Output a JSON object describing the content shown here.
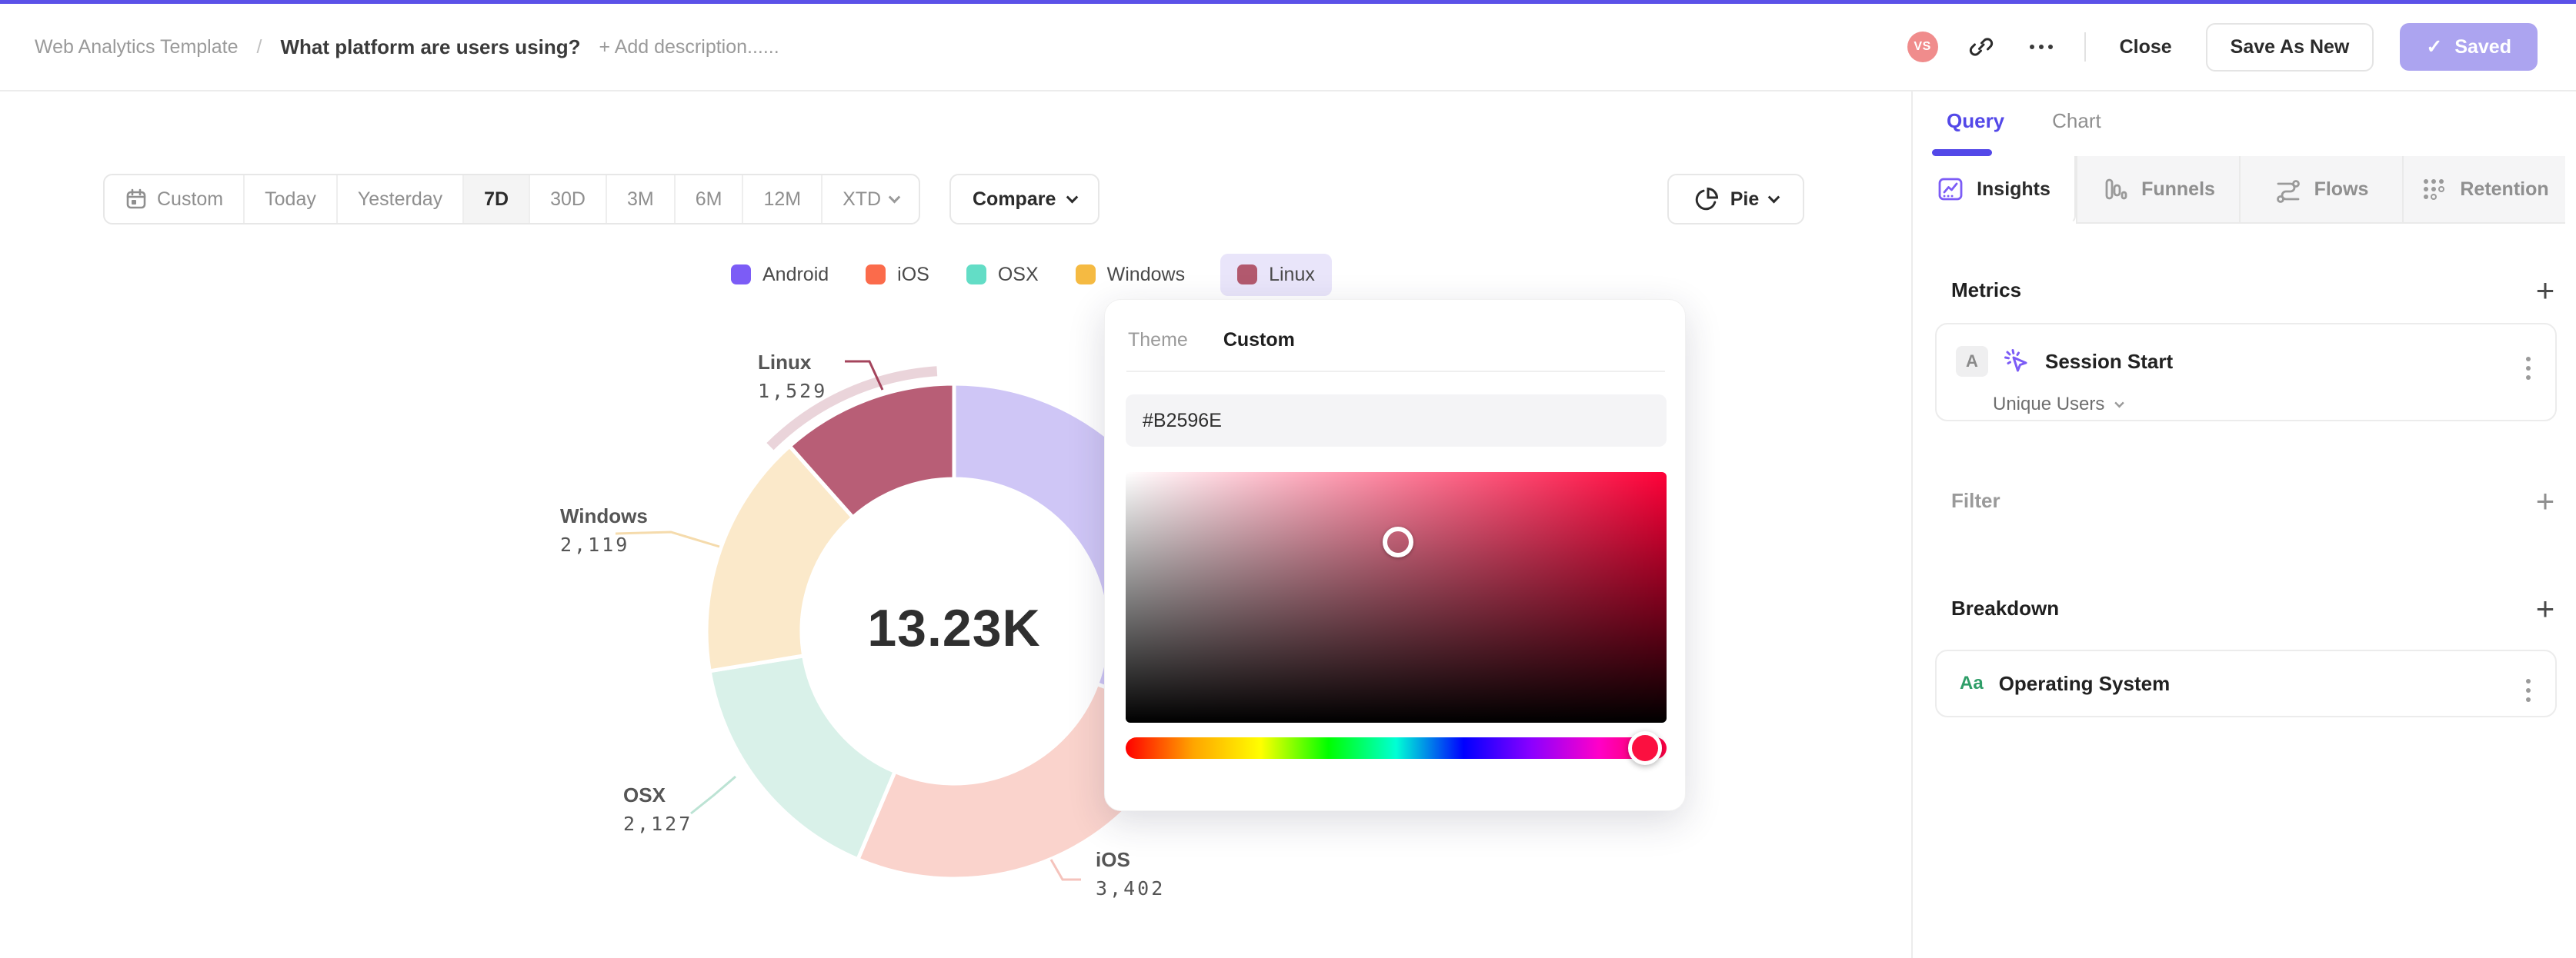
{
  "accent_color": "#5B51E8",
  "header": {
    "breadcrumb_root": "Web Analytics Template",
    "slash": "/",
    "title": "What platform are users using?",
    "add_description_label": "+ Add description......",
    "avatar_initials": "VS",
    "close_label": "Close",
    "save_as_new_label": "Save As New",
    "saved_label": "Saved",
    "saved_check": "✓",
    "saved_bg": "#ACA4F0"
  },
  "toolbar": {
    "ranges": [
      "Custom",
      "Today",
      "Yesterday",
      "7D",
      "30D",
      "3M",
      "6M",
      "12M",
      "XTD"
    ],
    "selected_range": "7D",
    "compare_label": "Compare",
    "chart_type_label": "Pie"
  },
  "chart_data": {
    "type": "pie",
    "center_label": "13.23K",
    "total": 13230,
    "legend_position": "top",
    "series": [
      {
        "name": "Android",
        "value": 4053,
        "color": "#7C5CF6",
        "slice_color": "#CFC6F6",
        "label_visible": false
      },
      {
        "name": "iOS",
        "value": 3402,
        "display_value": "3,402",
        "color": "#FB6B4B",
        "slice_color": "#FAD3CC",
        "label_visible": true
      },
      {
        "name": "OSX",
        "value": 2127,
        "display_value": "2,127",
        "color": "#63DDC6",
        "slice_color": "#D9F1E9",
        "label_visible": true
      },
      {
        "name": "Windows",
        "value": 2119,
        "display_value": "2,119",
        "color": "#F5BA42",
        "slice_color": "#FBE9CA",
        "label_visible": true
      },
      {
        "name": "Linux",
        "value": 1529,
        "display_value": "1,529",
        "color": "#B2596E",
        "slice_color": "#B85E76",
        "selected": true,
        "label_visible": true
      }
    ]
  },
  "color_picker": {
    "tabs": [
      "Theme",
      "Custom"
    ],
    "active_tab": "Custom",
    "hex_value": "#B2596E",
    "base_hue_color": "#FF0038",
    "cursor_x_percent": 50.4,
    "cursor_y_percent": 28,
    "hue_percent": 96
  },
  "sidebar": {
    "tabs": [
      {
        "label": "Query",
        "active": true
      },
      {
        "label": "Chart",
        "active": false
      }
    ],
    "view_tabs": [
      {
        "label": "Insights",
        "icon": "insights-icon",
        "active": true
      },
      {
        "label": "Funnels",
        "icon": "funnels-icon",
        "active": false
      },
      {
        "label": "Flows",
        "icon": "flows-icon",
        "active": false
      },
      {
        "label": "Retention",
        "icon": "retention-icon",
        "active": false
      }
    ],
    "metrics": {
      "heading": "Metrics",
      "add_label": "+",
      "card": {
        "badge": "A",
        "label": "Session Start",
        "aggregation": "Unique Users"
      }
    },
    "filter": {
      "heading": "Filter",
      "add_label": "+"
    },
    "breakdown": {
      "heading": "Breakdown",
      "add_label": "+",
      "card": {
        "icon_label": "Aa",
        "label": "Operating System"
      }
    },
    "query_accent": "#5348E8",
    "insights_icon_color": "#7C5CF6"
  }
}
